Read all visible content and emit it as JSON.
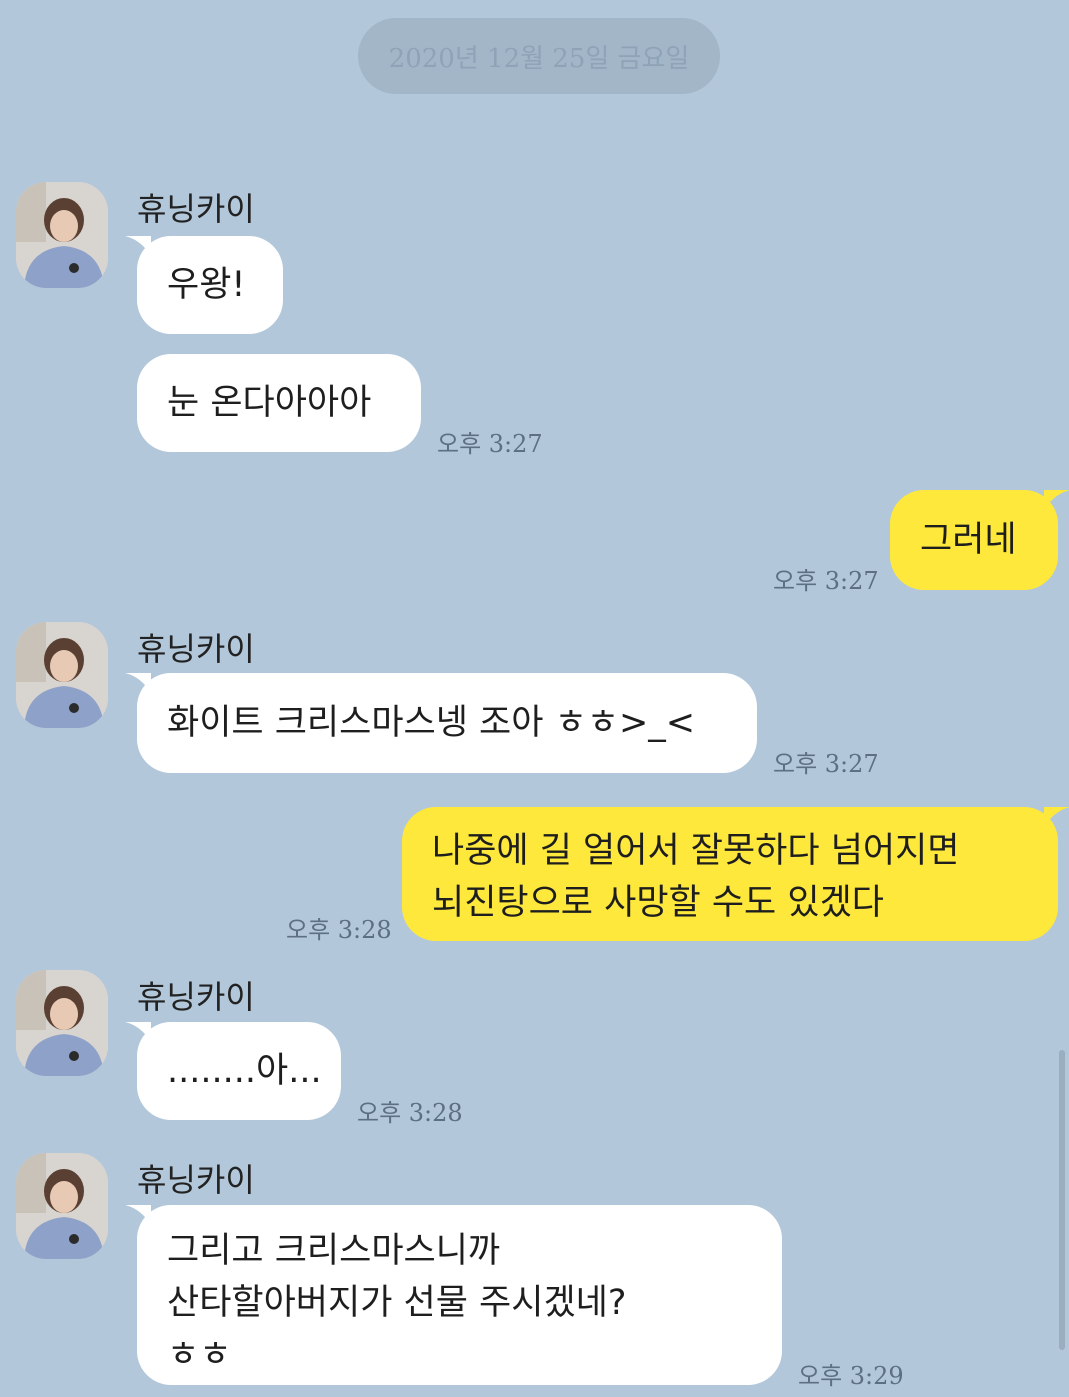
{
  "date_divider": "2020년 12월 25일 금요일",
  "sender_name": "휴닝카이",
  "messages": {
    "m1": "우왕!",
    "m2": "눈 온다아아아",
    "m2_time": "오후 3:27",
    "m3": "그러네",
    "m3_time": "오후 3:27",
    "m4": "화이트 크리스마스넹 조아 ㅎㅎ>_<",
    "m4_time": "오후 3:27",
    "m5_line1": "나중에 길 얼어서 잘못하다 넘어지면",
    "m5_line2": "뇌진탕으로 사망할 수도 있겠다",
    "m5_time": "오후 3:28",
    "m6": "........아...",
    "m6_time": "오후 3:28",
    "m7_line1": "그리고 크리스마스니까",
    "m7_line2": "산타할아버지가 선물 주시겠네?",
    "m7_line3": "ㅎㅎ",
    "m7_time": "오후 3:29"
  },
  "colors": {
    "background": "#b2c7da",
    "incoming_bubble": "#ffffff",
    "outgoing_bubble": "#fee83c"
  }
}
